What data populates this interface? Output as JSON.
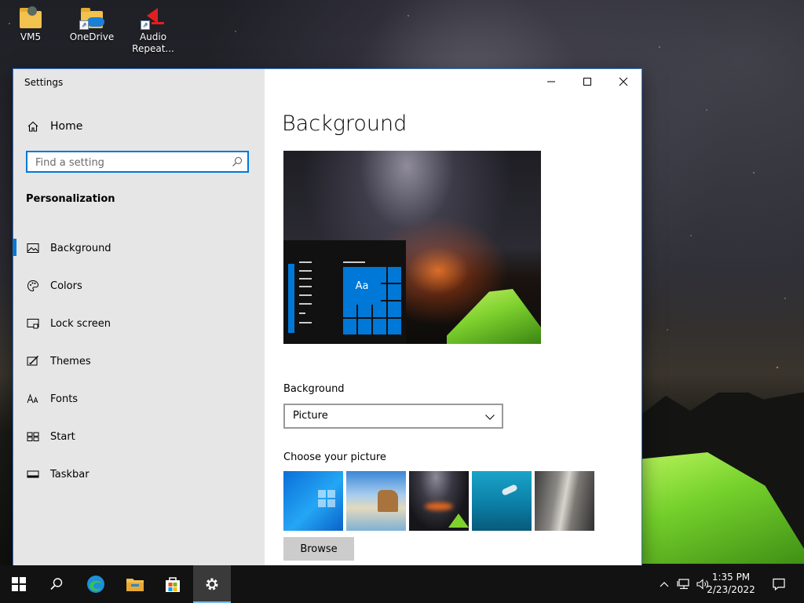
{
  "desktop": {
    "icons": [
      {
        "label": "VM5"
      },
      {
        "label": "OneDrive"
      },
      {
        "label": "Audio Repeat..."
      }
    ]
  },
  "window": {
    "title": "Settings",
    "caption_icons": [
      "minimize-icon",
      "maximize-icon",
      "close-icon"
    ]
  },
  "sidebar": {
    "home_label": "Home",
    "search_placeholder": "Find a setting",
    "section_header": "Personalization",
    "items": [
      {
        "label": "Background",
        "icon": "picture-icon",
        "active": true
      },
      {
        "label": "Colors",
        "icon": "palette-icon"
      },
      {
        "label": "Lock screen",
        "icon": "lock-screen-icon"
      },
      {
        "label": "Themes",
        "icon": "themes-icon"
      },
      {
        "label": "Fonts",
        "icon": "fonts-icon"
      },
      {
        "label": "Start",
        "icon": "start-icon"
      },
      {
        "label": "Taskbar",
        "icon": "taskbar-icon"
      }
    ]
  },
  "main": {
    "page_title": "Background",
    "preview_tile_text": "Aa",
    "background_label": "Background",
    "background_value": "Picture",
    "choose_label": "Choose your picture",
    "browse_label": "Browse"
  },
  "taskbar": {
    "pinned": [
      "start-icon",
      "search-icon",
      "edge-icon",
      "file-explorer-icon",
      "store-icon",
      "settings-icon"
    ],
    "active": "settings-icon",
    "time": "1:35 PM",
    "date": "2/23/2022"
  },
  "colors": {
    "accent": "#0078d7",
    "sidebar_bg": "#e6e6e6",
    "taskbar_bg": "#121212"
  }
}
